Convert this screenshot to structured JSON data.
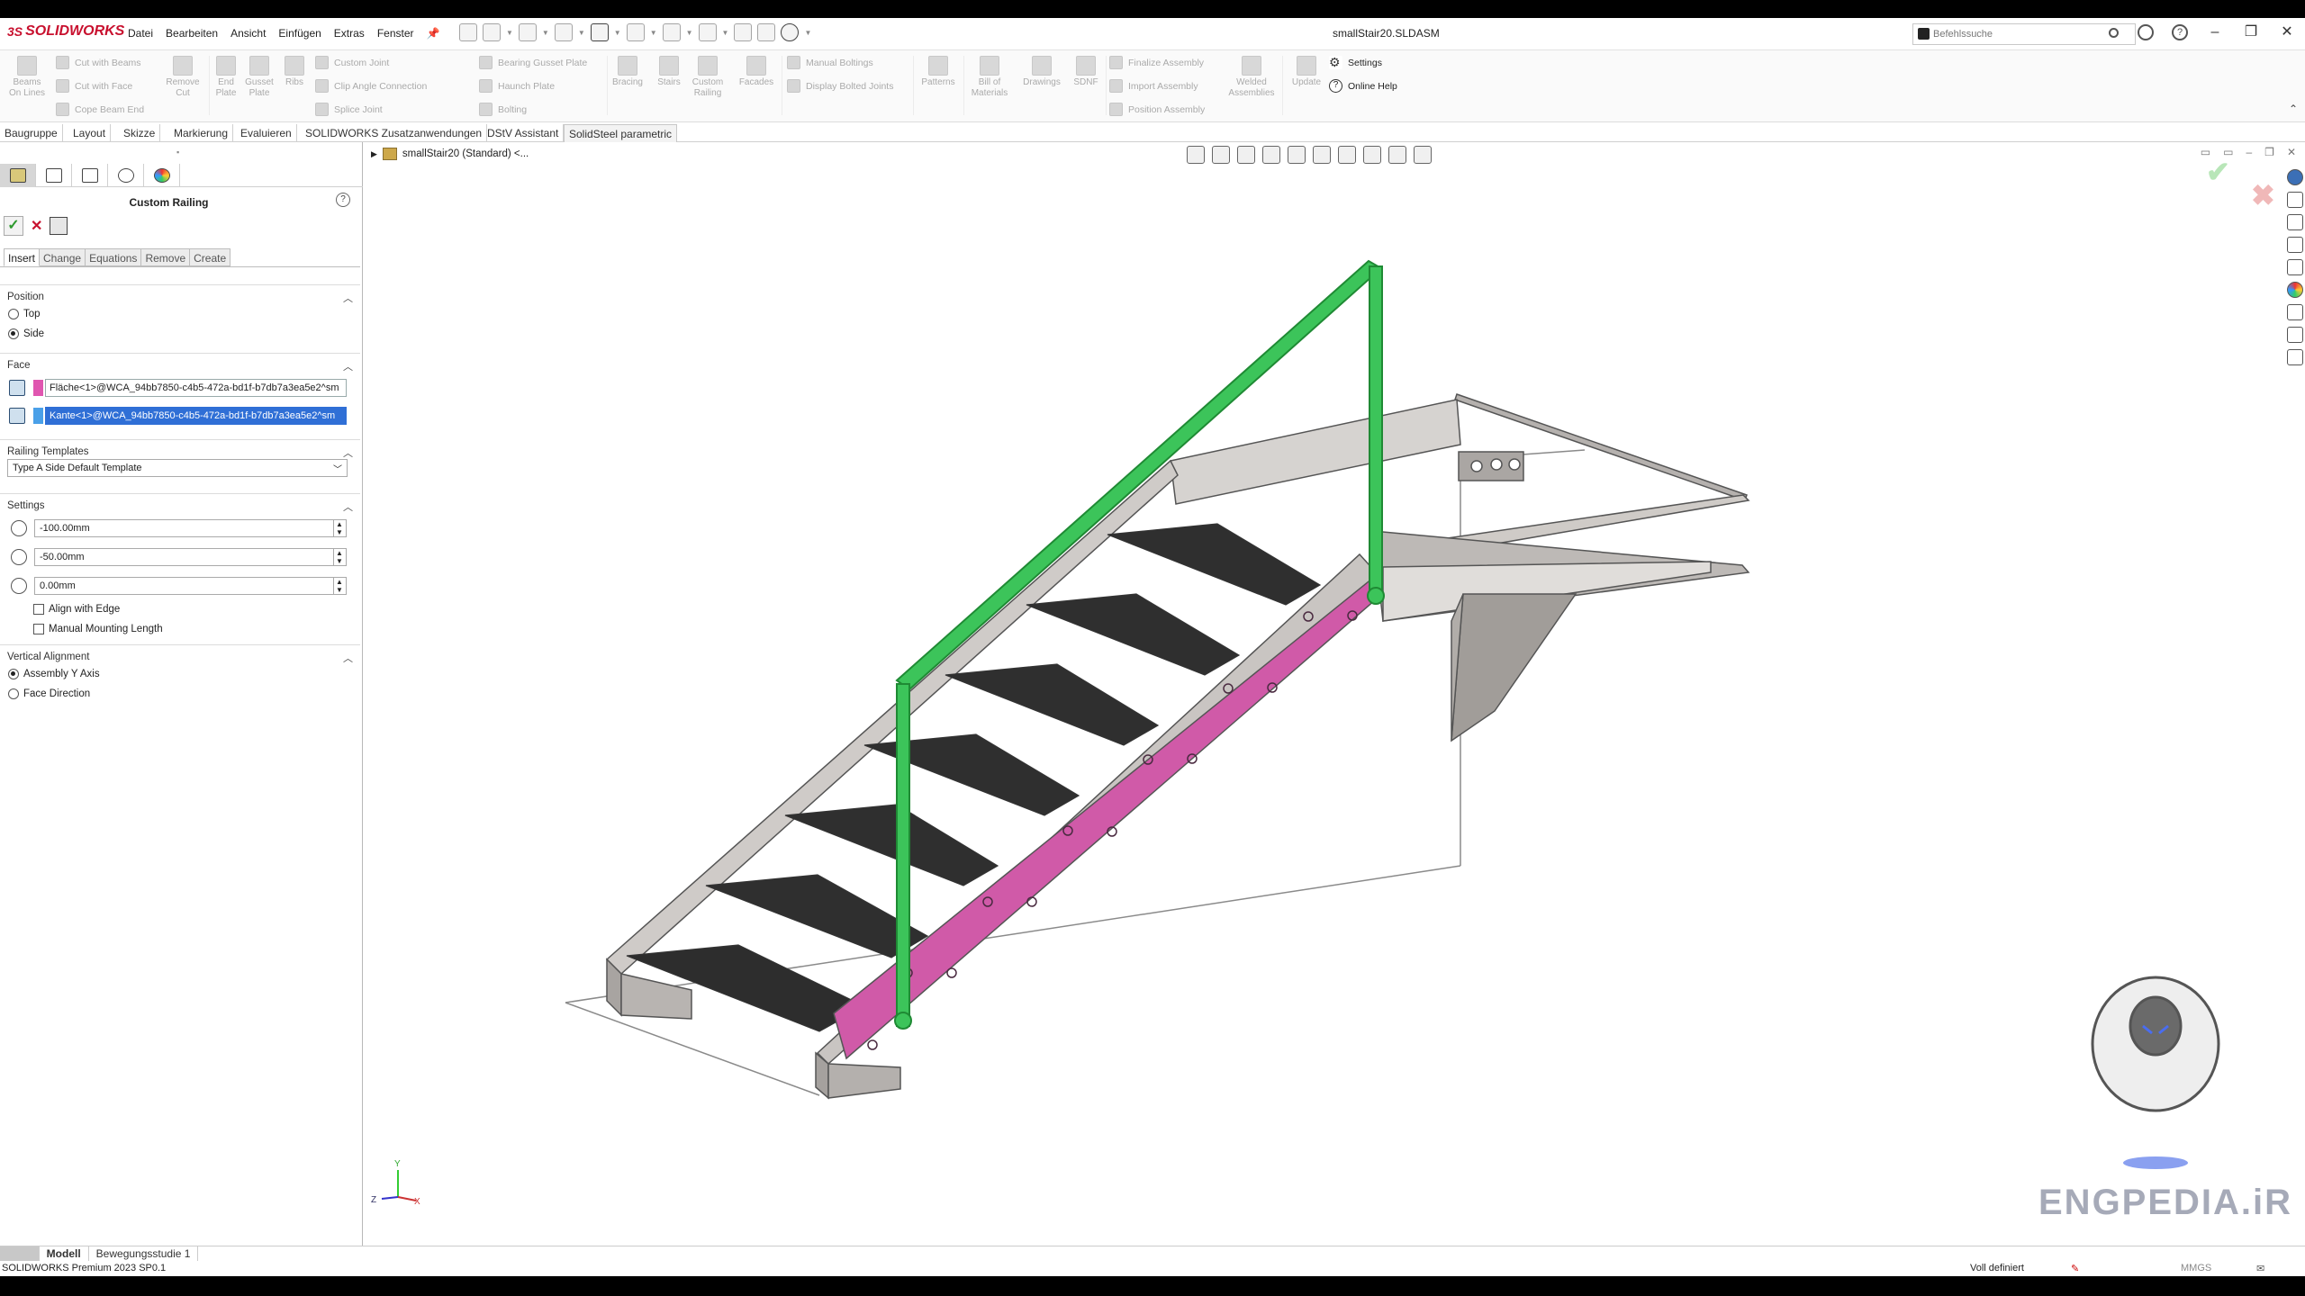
{
  "app": {
    "brand": "SOLIDWORKS",
    "document_title": "smallStair20.SLDASM",
    "menu": [
      "Datei",
      "Bearbeiten",
      "Ansicht",
      "Einfügen",
      "Extras",
      "Fenster"
    ],
    "search_placeholder": "Befehlssuche"
  },
  "ribbon": {
    "buttons_large": [
      {
        "label": "Beams\nOn Lines"
      },
      {
        "label": "Remove\nCut"
      },
      {
        "label": "End\nPlate"
      },
      {
        "label": "Gusset\nPlate"
      },
      {
        "label": "Ribs"
      },
      {
        "label": "Bracing"
      },
      {
        "label": "Stairs"
      },
      {
        "label": "Custom\nRailing"
      },
      {
        "label": "Facades"
      },
      {
        "label": "Patterns"
      },
      {
        "label": "Bill of\nMaterials"
      },
      {
        "label": "Drawings"
      },
      {
        "label": "SDNF"
      },
      {
        "label": "Welded\nAssemblies"
      },
      {
        "label": "Update"
      }
    ],
    "small": [
      "Cut with Beams",
      "Cut with Face",
      "Cope Beam End",
      "Custom Joint",
      "Clip Angle Connection",
      "Splice Joint",
      "Bearing Gusset Plate",
      "Haunch Plate",
      "Bolting",
      "Manual Boltings",
      "Display Bolted Joints",
      "Finalize Assembly",
      "Import Assembly",
      "Position Assembly"
    ],
    "settings": "Settings",
    "online_help": "Online Help"
  },
  "cm_tabs": [
    "Baugruppe",
    "Layout",
    "Skizze",
    "Markierung",
    "Evaluieren",
    "SOLIDWORKS Zusatzanwendungen",
    "DStV Assistant",
    "SolidSteel parametric"
  ],
  "cm_active": "SolidSteel parametric",
  "pm": {
    "title": "Custom Railing",
    "help": "?",
    "tabs": [
      "Insert",
      "Change",
      "Equations",
      "Remove",
      "Create"
    ],
    "position": {
      "header": "Position",
      "options": [
        "Top",
        "Side"
      ],
      "selected": "Side"
    },
    "face": {
      "header": "Face",
      "sel1": "Fläche<1>@WCA_94bb7850-c4b5-472a-bd1f-b7db7a3ea5e2^sm",
      "sel2": "Kante<1>@WCA_94bb7850-c4b5-472a-bd1f-b7db7a3ea5e2^sm",
      "sel1_color": "#e056b0",
      "sel2_color": "#4aa0e8"
    },
    "railing_templates": {
      "header": "Railing Templates",
      "value": "Type A Side Default Template"
    },
    "settings": {
      "header": "Settings",
      "values": [
        "-100.00mm",
        "-50.00mm",
        "0.00mm"
      ],
      "align_with_edge": "Align with Edge",
      "manual_mounting": "Manual Mounting Length"
    },
    "vertical_alignment": {
      "header": "Vertical Alignment",
      "options": [
        "Assembly Y Axis",
        "Face Direction"
      ],
      "selected": "Assembly Y Axis"
    }
  },
  "viewport": {
    "tree_root": "smallStair20 (Standard) <...",
    "triad": {
      "x": "X",
      "y": "Y",
      "z": "Z"
    }
  },
  "status": {
    "tabs": [
      "Modell",
      "Bewegungsstudie 1"
    ],
    "left_text": "SOLIDWORKS Premium 2023 SP0.1",
    "state": "Voll definiert",
    "units": "MMGS"
  },
  "watermark": "ENGPEDIA.iR",
  "colors": {
    "railing": "#3cc45a",
    "highlight": "#d05aa8",
    "steel": "#c9c5c2",
    "treads": "#2f2f2f",
    "accent": "#c8102e"
  }
}
